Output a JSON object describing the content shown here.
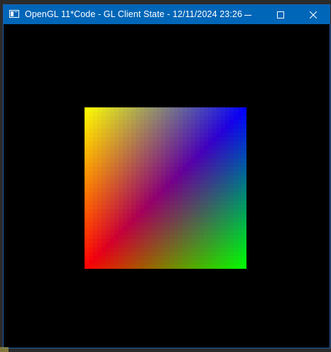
{
  "window": {
    "title": "OpenGL 11*Code - GL Client State - 12/11/2024 23:26",
    "icon": "app-window-icon",
    "controls": {
      "minimize_icon": "minimize-icon",
      "maximize_icon": "maximize-icon",
      "close_icon": "close-icon"
    }
  },
  "scene": {
    "background_color": "#000000",
    "quad": {
      "vertex_colors": {
        "top_left": "#ffff00",
        "top_right": "#0000ff",
        "bottom_left": "#ff0000",
        "bottom_right": "#00ff00"
      }
    }
  },
  "colors": {
    "titlebar": "#0066b8",
    "title_text": "#ffffff",
    "border": "#1d5fa6"
  }
}
